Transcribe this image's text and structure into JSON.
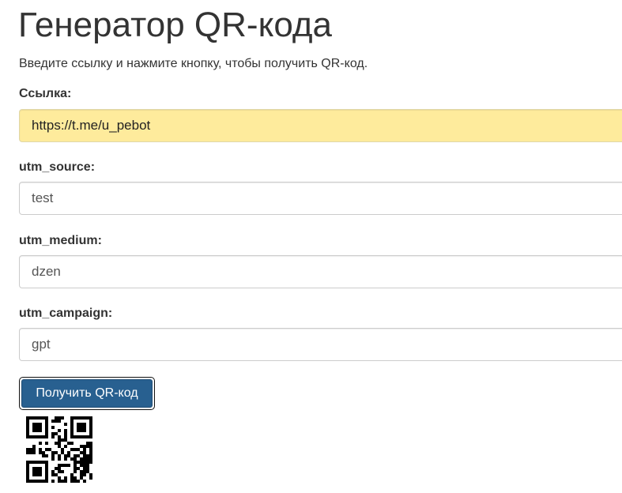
{
  "page": {
    "title": "Генератор QR-кода",
    "subtitle": "Введите ссылку и нажмите кнопку, чтобы получить QR-код."
  },
  "form": {
    "link": {
      "label": "Ссылка:",
      "value": "https://t.me/u_pebot"
    },
    "utm_source": {
      "label": "utm_source:",
      "value": "test"
    },
    "utm_medium": {
      "label": "utm_medium:",
      "value": "dzen"
    },
    "utm_campaign": {
      "label": "utm_campaign:",
      "value": "gpt"
    },
    "submit_label": "Получить QR-код"
  },
  "colors": {
    "autofill_background": "#feeb9c",
    "button_background": "#286090"
  },
  "qr": {
    "icon": "qr-code-icon"
  }
}
